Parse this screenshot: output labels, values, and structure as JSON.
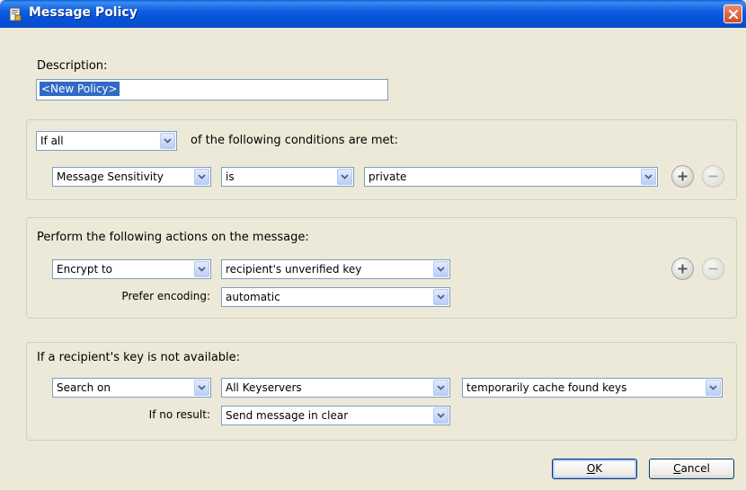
{
  "window": {
    "title": "Message Policy",
    "icon": "policy-document-icon",
    "close_icon": "close-icon"
  },
  "description": {
    "label": "Description:",
    "value": "<New Policy>"
  },
  "conditions": {
    "match_mode": "If all",
    "match_suffix": "of the following conditions are met:",
    "rule": {
      "field": "Message Sensitivity",
      "operator": "is",
      "value": "private"
    }
  },
  "actions": {
    "heading": "Perform the following actions on the message:",
    "action": "Encrypt to",
    "target": "recipient's unverified key",
    "encoding_label": "Prefer encoding:",
    "encoding": "automatic"
  },
  "key_unavailable": {
    "heading": "If a recipient's key is not available:",
    "action": "Search on",
    "keyserver": "All Keyservers",
    "cache_option": "temporarily cache found keys",
    "no_result_label": "If no result:",
    "no_result_action": "Send message in clear"
  },
  "buttons": {
    "ok_mnemonic": "O",
    "ok_rest": "K",
    "cancel_mnemonic": "C",
    "cancel_rest": "ancel"
  },
  "colors": {
    "titlebar": "#0551d9",
    "dialog_bg": "#ece9d8",
    "close_button": "#d24a24",
    "selection": "#316ac5"
  }
}
